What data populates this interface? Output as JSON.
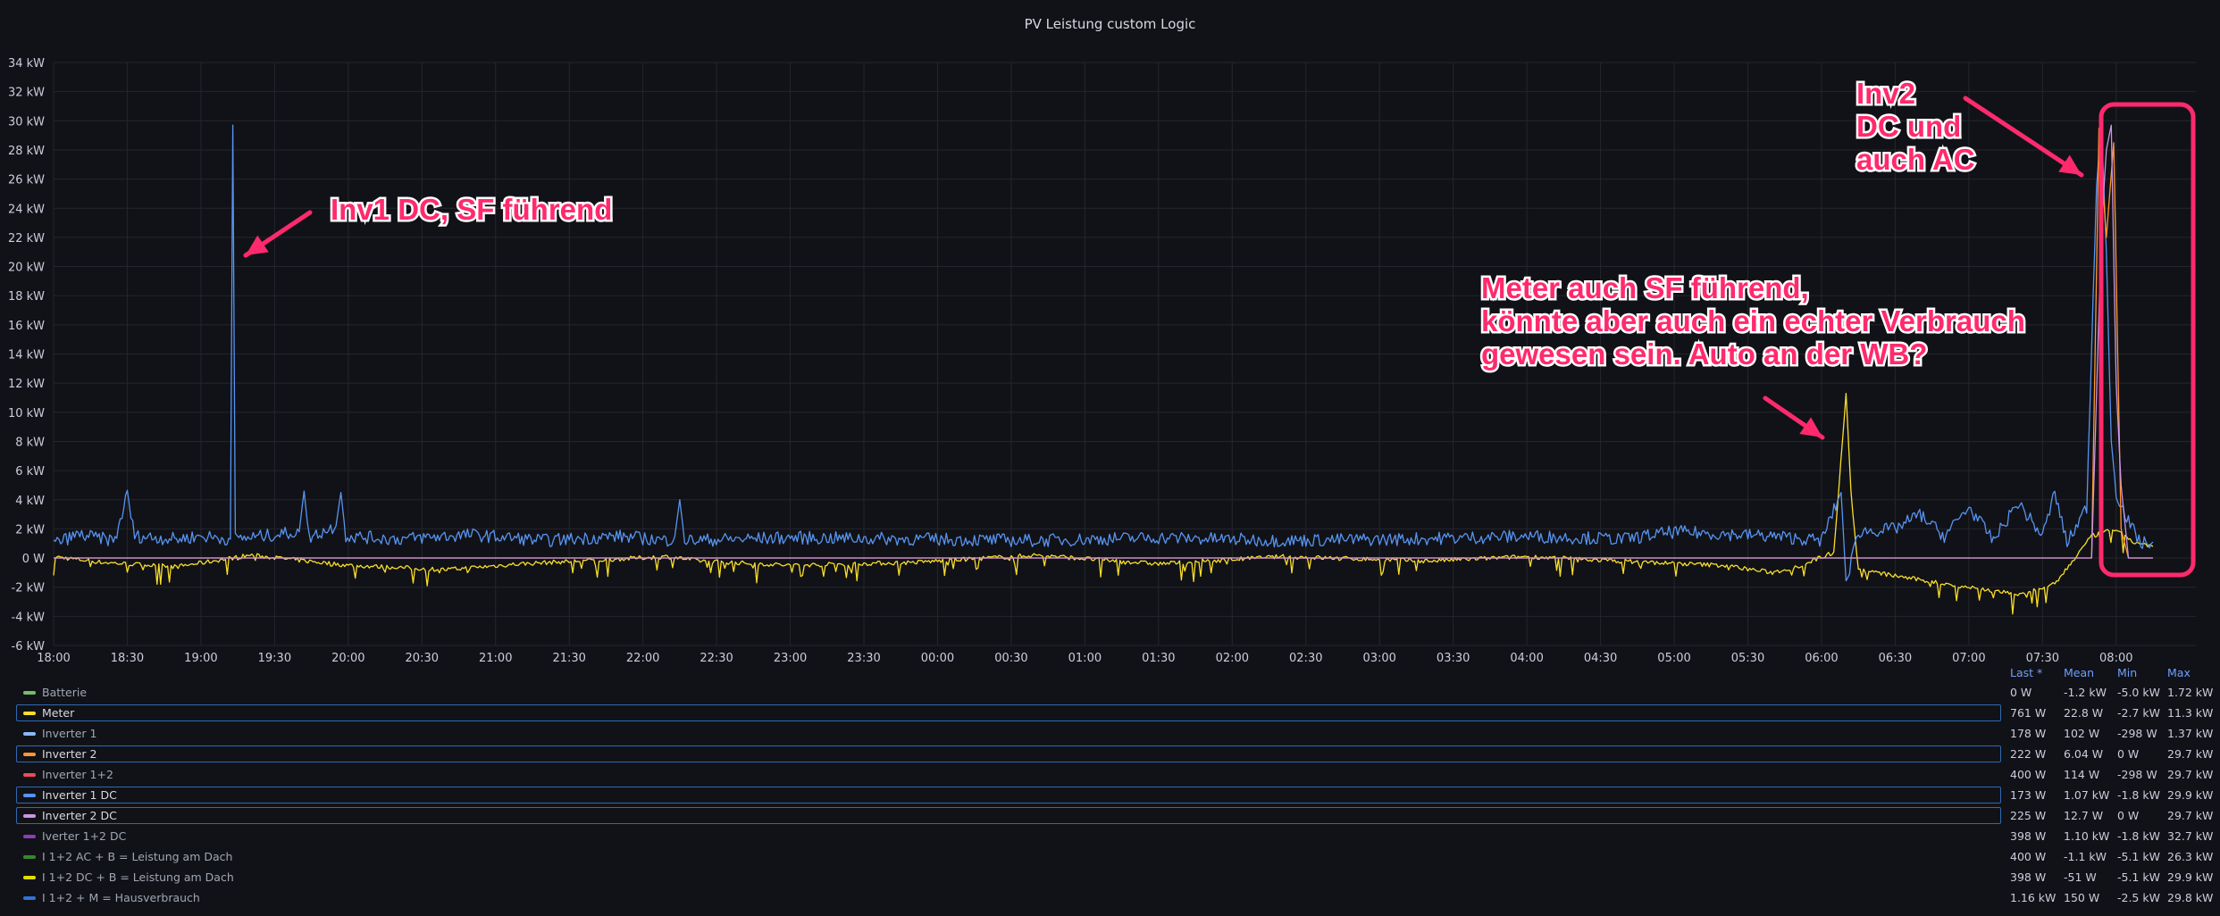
{
  "panel": {
    "title": "PV Leistung custom Logic"
  },
  "chart_data": {
    "type": "line",
    "title": "PV Leistung custom Logic",
    "y_ticks": [
      "34 kW",
      "32 kW",
      "30 kW",
      "28 kW",
      "26 kW",
      "24 kW",
      "22 kW",
      "20 kW",
      "18 kW",
      "16 kW",
      "14 kW",
      "12 kW",
      "10 kW",
      "8 kW",
      "6 kW",
      "4 kW",
      "2 kW",
      "0 W",
      "-2 kW",
      "-4 kW",
      "-6 kW"
    ],
    "ylim": [
      -6,
      34
    ],
    "y_unit": "kW",
    "x_ticks": [
      "18:00",
      "18:30",
      "19:00",
      "19:30",
      "20:00",
      "20:30",
      "21:00",
      "21:30",
      "22:00",
      "22:30",
      "23:00",
      "23:30",
      "00:00",
      "00:30",
      "01:00",
      "01:30",
      "02:00",
      "02:30",
      "03:00",
      "03:30",
      "04:00",
      "04:30",
      "05:00",
      "05:30",
      "06:00",
      "06:30",
      "07:00",
      "07:30",
      "08:00"
    ],
    "x_range_minutes": [
      0,
      855
    ],
    "grid": true,
    "legend_position": "bottom",
    "series": [
      {
        "name": "Batterie",
        "color": "#73bf69"
      },
      {
        "name": "Meter",
        "color": "#fade2a",
        "points": [
          [
            0,
            0.1
          ],
          [
            20,
            -0.3
          ],
          [
            50,
            -0.6
          ],
          [
            80,
            0.2
          ],
          [
            120,
            -0.5
          ],
          [
            160,
            -0.8
          ],
          [
            190,
            -0.4
          ],
          [
            250,
            0.1
          ],
          [
            264,
            -0.2
          ],
          [
            300,
            -0.5
          ],
          [
            350,
            -0.3
          ],
          [
            400,
            0.2
          ],
          [
            450,
            -0.4
          ],
          [
            500,
            0.1
          ],
          [
            560,
            -0.2
          ],
          [
            600,
            0.1
          ],
          [
            650,
            -0.3
          ],
          [
            680,
            -0.5
          ],
          [
            700,
            -1.0
          ],
          [
            710,
            -0.6
          ],
          [
            725,
            0.4
          ],
          [
            730,
            11.3
          ],
          [
            732,
            4.5
          ],
          [
            735,
            -0.8
          ],
          [
            760,
            -1.5
          ],
          [
            780,
            -2.0
          ],
          [
            800,
            -2.5
          ],
          [
            815,
            -1.8
          ],
          [
            830,
            1.5
          ],
          [
            840,
            2.0
          ],
          [
            845,
            1.2
          ],
          [
            855,
            0.8
          ]
        ]
      },
      {
        "name": "Inverter 1",
        "color": "#8ab8ff"
      },
      {
        "name": "Inverter 2",
        "color": "#ff9830",
        "points": [
          [
            0,
            0
          ],
          [
            830,
            0
          ],
          [
            833,
            29.5
          ],
          [
            836,
            22.0
          ],
          [
            839,
            28.5
          ],
          [
            842,
            2.0
          ],
          [
            845,
            0
          ],
          [
            855,
            0
          ]
        ]
      },
      {
        "name": "Inverter 1+2",
        "color": "#f2495c"
      },
      {
        "name": "Inverter 1 DC",
        "color": "#5794f2",
        "points": [
          [
            0,
            1.0
          ],
          [
            10,
            1.6
          ],
          [
            25,
            1.2
          ],
          [
            30,
            4.4
          ],
          [
            33,
            1.5
          ],
          [
            50,
            1.3
          ],
          [
            60,
            1.5
          ],
          [
            72,
            1.3
          ],
          [
            73,
            29.7
          ],
          [
            74,
            1.3
          ],
          [
            90,
            1.6
          ],
          [
            100,
            1.8
          ],
          [
            102,
            4.6
          ],
          [
            104,
            1.4
          ],
          [
            115,
            2.2
          ],
          [
            117,
            4.5
          ],
          [
            119,
            1.5
          ],
          [
            140,
            1.3
          ],
          [
            170,
            1.6
          ],
          [
            200,
            1.2
          ],
          [
            230,
            1.5
          ],
          [
            250,
            1.2
          ],
          [
            253,
            1.5
          ],
          [
            255,
            4.0
          ],
          [
            257,
            1.2
          ],
          [
            300,
            1.4
          ],
          [
            350,
            1.3
          ],
          [
            400,
            1.2
          ],
          [
            450,
            1.4
          ],
          [
            500,
            1.2
          ],
          [
            550,
            1.3
          ],
          [
            600,
            1.5
          ],
          [
            640,
            1.3
          ],
          [
            660,
            1.8
          ],
          [
            700,
            1.5
          ],
          [
            720,
            1.2
          ],
          [
            728,
            4.5
          ],
          [
            730,
            -1.7
          ],
          [
            735,
            1.8
          ],
          [
            750,
            2.0
          ],
          [
            760,
            3.0
          ],
          [
            770,
            1.5
          ],
          [
            780,
            3.5
          ],
          [
            790,
            1.2
          ],
          [
            800,
            3.8
          ],
          [
            810,
            1.5
          ],
          [
            815,
            4.5
          ],
          [
            820,
            1.0
          ],
          [
            828,
            3.5
          ],
          [
            832,
            25.5
          ],
          [
            834,
            29.9
          ],
          [
            836,
            21.0
          ],
          [
            838,
            8.0
          ],
          [
            840,
            4.5
          ],
          [
            845,
            2.5
          ],
          [
            850,
            1.0
          ],
          [
            855,
            1.1
          ]
        ]
      },
      {
        "name": "Inverter 2 DC",
        "color": "#ca95e5",
        "points": [
          [
            0,
            0
          ],
          [
            830,
            0
          ],
          [
            834,
            22.5
          ],
          [
            836,
            28.0
          ],
          [
            838,
            29.7
          ],
          [
            840,
            12.0
          ],
          [
            842,
            5.0
          ],
          [
            845,
            0
          ],
          [
            855,
            0
          ]
        ]
      },
      {
        "name": "Iverter 1+2 DC",
        "color": "#8f3bb8"
      },
      {
        "name": "I 1+2 AC + B = Leistung am Dach",
        "color": "#37872d"
      },
      {
        "name": "I 1+2 DC + B = Leistung am Dach",
        "color": "#e0e000"
      },
      {
        "name": "I 1+2 + M = Hausverbrauch",
        "color": "#3274d9"
      }
    ],
    "annotations": [
      {
        "lines": [
          "Inv1 DC, SF führend"
        ]
      },
      {
        "lines": [
          "Meter auch SF führend,",
          "könnte aber auch ein echter Verbrauch",
          "gewesen sein. Auto an der WB?"
        ]
      },
      {
        "lines": [
          "Inv2",
          "DC und",
          "auch AC"
        ]
      }
    ]
  },
  "legend": {
    "columns": [
      "Last *",
      "Mean",
      "Min",
      "Max"
    ],
    "rows": [
      {
        "name": "Batterie",
        "color": "#73bf69",
        "highlighted": false,
        "last": "0 W",
        "mean": "-1.2 kW",
        "min": "-5.0 kW",
        "max": "1.72 kW"
      },
      {
        "name": "Meter",
        "color": "#fade2a",
        "highlighted": true,
        "last": "761 W",
        "mean": "22.8 W",
        "min": "-2.7 kW",
        "max": "11.3 kW"
      },
      {
        "name": "Inverter 1",
        "color": "#8ab8ff",
        "highlighted": false,
        "last": "178 W",
        "mean": "102 W",
        "min": "-298 W",
        "max": "1.37 kW"
      },
      {
        "name": "Inverter 2",
        "color": "#ff9830",
        "highlighted": true,
        "last": "222 W",
        "mean": "6.04 W",
        "min": "0 W",
        "max": "29.7 kW"
      },
      {
        "name": "Inverter 1+2",
        "color": "#f2495c",
        "highlighted": false,
        "last": "400 W",
        "mean": "114 W",
        "min": "-298 W",
        "max": "29.7 kW"
      },
      {
        "name": "Inverter 1 DC",
        "color": "#5794f2",
        "highlighted": true,
        "last": "173 W",
        "mean": "1.07 kW",
        "min": "-1.8 kW",
        "max": "29.9 kW"
      },
      {
        "name": "Inverter 2 DC",
        "color": "#ca95e5",
        "highlighted": true,
        "last": "225 W",
        "mean": "12.7 W",
        "min": "0 W",
        "max": "29.7 kW"
      },
      {
        "name": "Iverter 1+2 DC",
        "color": "#8f3bb8",
        "highlighted": false,
        "last": "398 W",
        "mean": "1.10 kW",
        "min": "-1.8 kW",
        "max": "32.7 kW"
      },
      {
        "name": "I 1+2 AC + B = Leistung am Dach",
        "color": "#37872d",
        "highlighted": false,
        "last": "400 W",
        "mean": "-1.1 kW",
        "min": "-5.1 kW",
        "max": "26.3 kW"
      },
      {
        "name": "I 1+2 DC + B = Leistung am Dach",
        "color": "#e0e000",
        "highlighted": false,
        "last": "398 W",
        "mean": "-51 W",
        "min": "-5.1 kW",
        "max": "29.9 kW"
      },
      {
        "name": "I 1+2 + M = Hausverbrauch",
        "color": "#3274d9",
        "highlighted": false,
        "last": "1.16 kW",
        "mean": "150 W",
        "min": "-2.5 kW",
        "max": "29.8 kW"
      }
    ]
  }
}
